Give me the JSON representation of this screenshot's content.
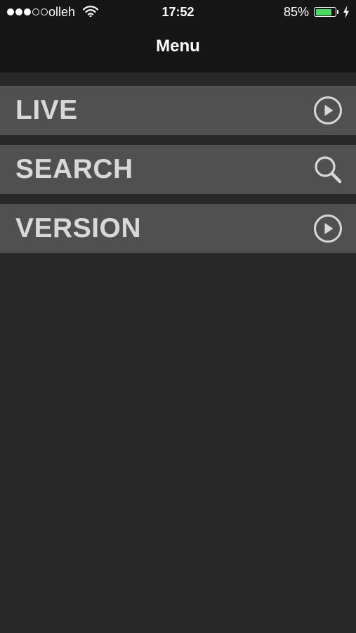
{
  "status_bar": {
    "carrier": "olleh",
    "time": "17:52",
    "battery_percent": "85%",
    "battery_level": 0.85,
    "signal_strength": 3,
    "signal_max": 5
  },
  "nav": {
    "title": "Menu"
  },
  "menu": {
    "items": [
      {
        "label": "LIVE",
        "icon": "play-circle-icon"
      },
      {
        "label": "SEARCH",
        "icon": "search-icon"
      },
      {
        "label": "VERSION",
        "icon": "play-circle-icon"
      }
    ]
  },
  "colors": {
    "background": "#282828",
    "header": "#161616",
    "menu_item": "#505050",
    "menu_text": "#d8d8d8",
    "battery": "#4cd964"
  }
}
